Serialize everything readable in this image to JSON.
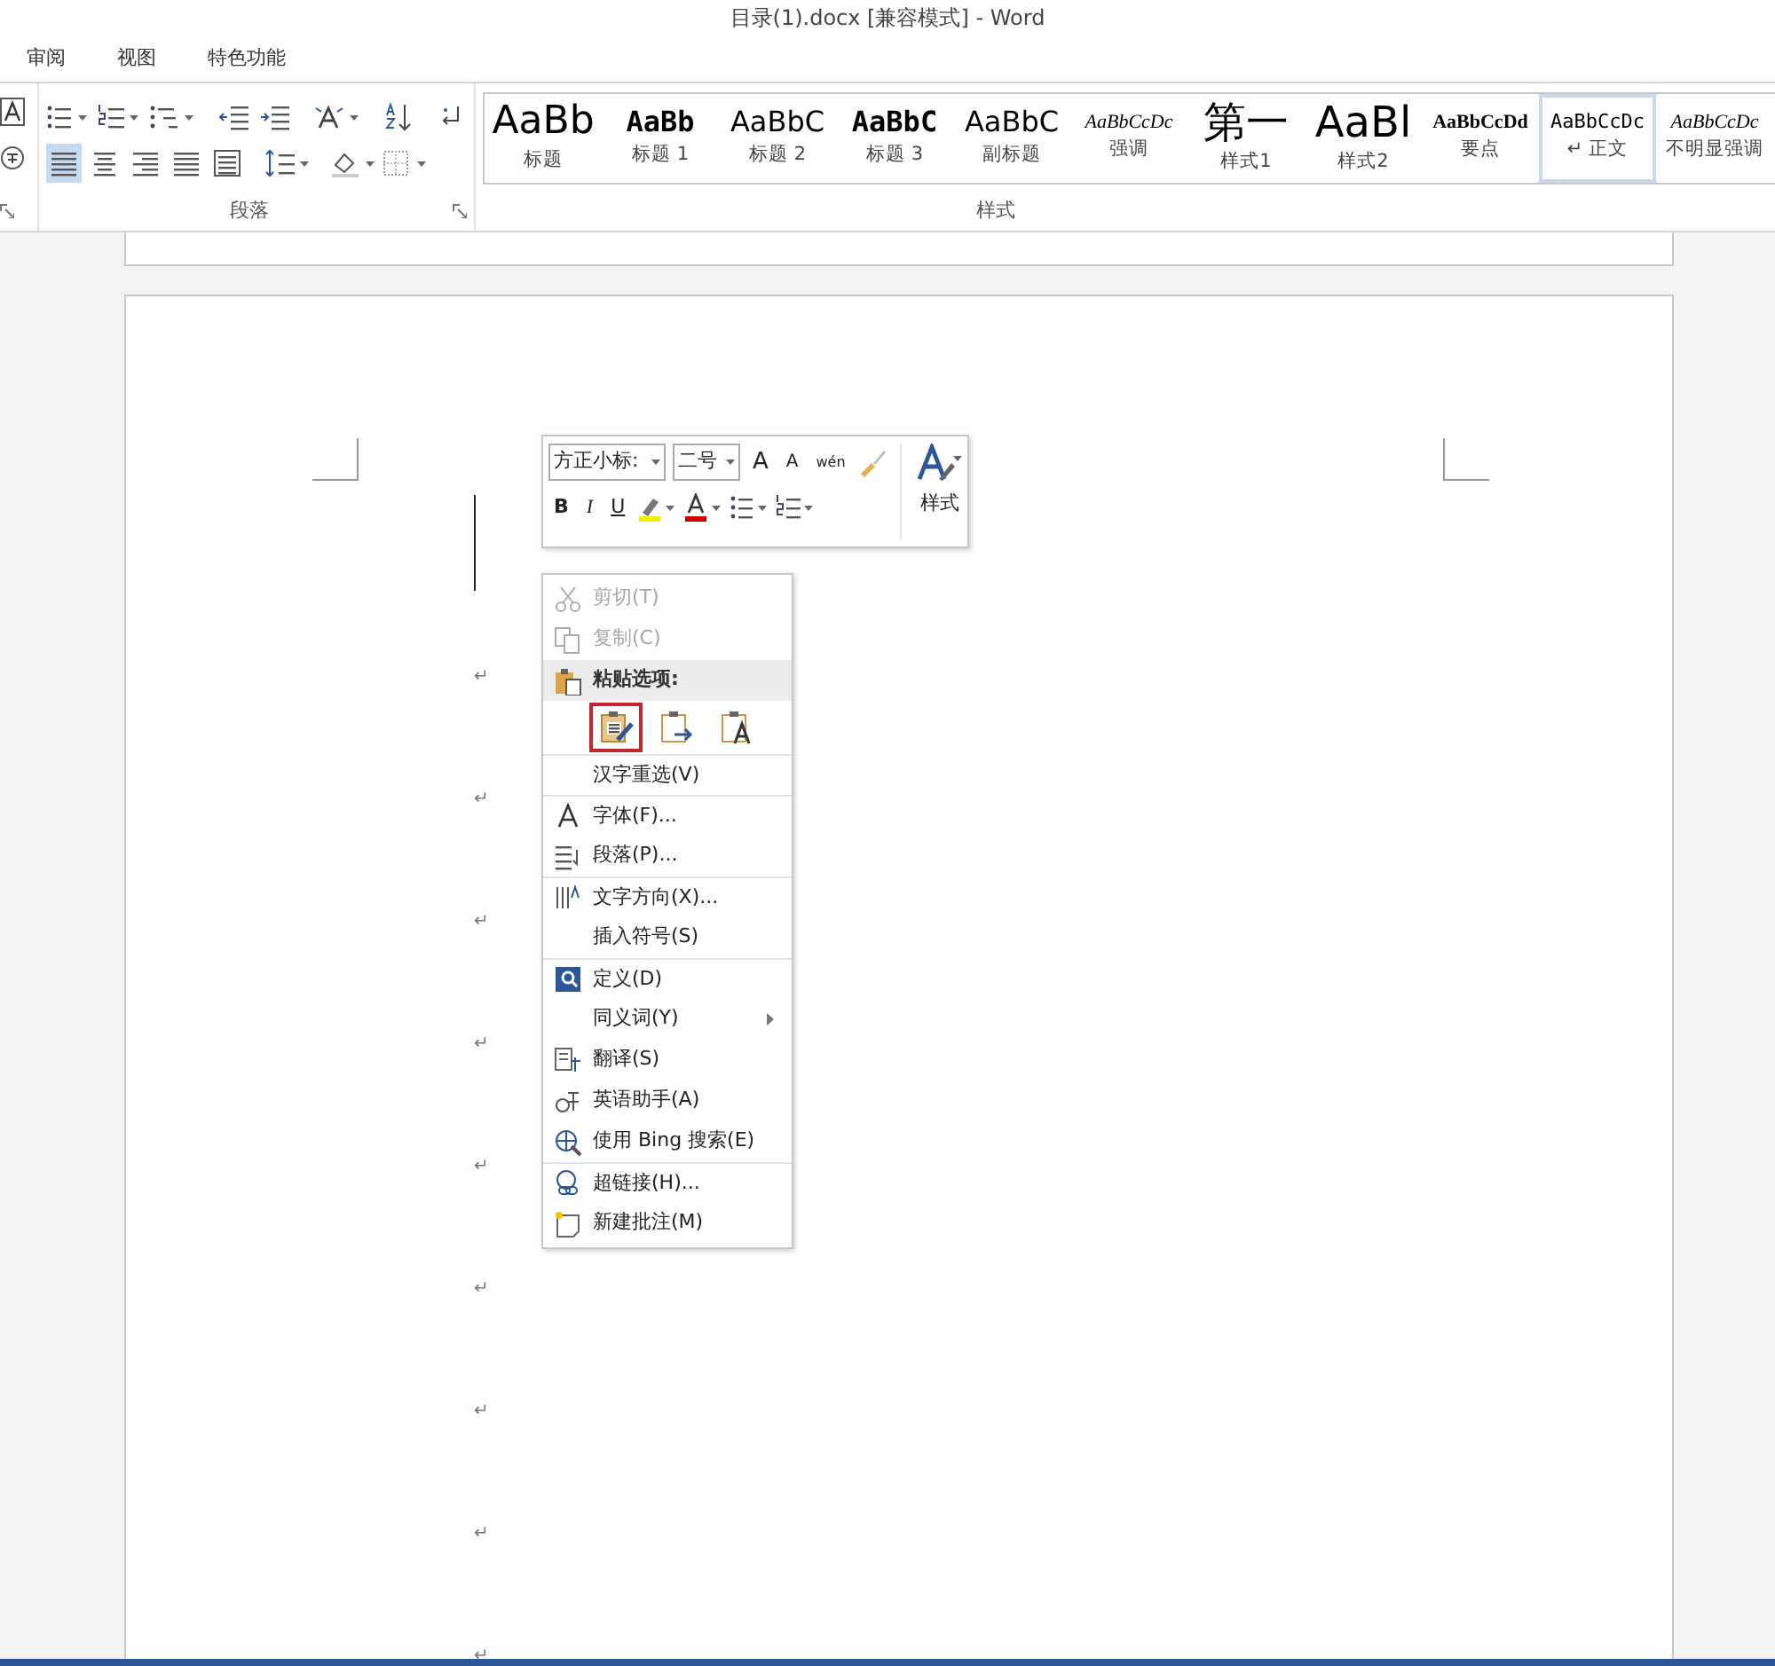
{
  "window": {
    "title": "目录(1).docx [兼容模式] - Word"
  },
  "tabs": [
    {
      "label": "审阅"
    },
    {
      "label": "视图"
    },
    {
      "label": "特色功能"
    }
  ],
  "paragraph_group": {
    "label": "段落",
    "alignment_buttons": [
      {
        "selected": true
      },
      {
        "selected": false
      },
      {
        "selected": false
      },
      {
        "selected": false
      },
      {
        "selected": false
      }
    ]
  },
  "styles_group": {
    "label": "样式",
    "items": [
      {
        "preview": "AaBb",
        "label": "标题",
        "kind": "title",
        "selected": false
      },
      {
        "preview": "AaBb",
        "label": "标题 1",
        "kind": "mono",
        "selected": false
      },
      {
        "preview": "AaBbC",
        "label": "标题 2",
        "kind": "sans",
        "selected": false
      },
      {
        "preview": "AaBbC",
        "label": "标题 3",
        "kind": "mono",
        "selected": false
      },
      {
        "preview": "AaBbC",
        "label": "副标题",
        "kind": "sans",
        "selected": false
      },
      {
        "preview": "AaBbCcDc",
        "label": "强调",
        "kind": "italic",
        "selected": false
      },
      {
        "preview": "第一",
        "label": "样式1",
        "kind": "big",
        "selected": false
      },
      {
        "preview": "AaBl",
        "label": "样式2",
        "kind": "big",
        "selected": false
      },
      {
        "preview": "AaBbCcDd",
        "label": "要点",
        "kind": "bold",
        "selected": false
      },
      {
        "preview": "AaBbCcDc",
        "label": "↵ 正文",
        "kind": "serif",
        "selected": true
      },
      {
        "preview": "AaBbCcDc",
        "label": "不明显强调",
        "kind": "italic",
        "selected": false
      }
    ]
  },
  "mini_toolbar": {
    "font": "方正小标:",
    "size": "二号",
    "grow": "A",
    "shrink": "A",
    "phonetic": "wén",
    "bold": "B",
    "italic": "I",
    "underline": "U",
    "styles_label": "样式"
  },
  "context_menu": [
    {
      "kind": "item",
      "label": "剪切(T)",
      "disabled": true,
      "separator_before": false
    },
    {
      "kind": "item",
      "label": "复制(C)",
      "disabled": true,
      "separator_before": false
    },
    {
      "kind": "header",
      "label": "粘贴选项:",
      "disabled": false,
      "separator_before": false
    },
    {
      "kind": "paste",
      "options": [
        {
          "selected": true
        },
        {
          "selected": false
        },
        {
          "selected": false
        }
      ]
    },
    {
      "kind": "item",
      "label": "汉字重选(V)",
      "disabled": false,
      "separator_before": true
    },
    {
      "kind": "item",
      "label": "字体(F)...",
      "disabled": false,
      "separator_before": true
    },
    {
      "kind": "item",
      "label": "段落(P)...",
      "disabled": false,
      "separator_before": false
    },
    {
      "kind": "item",
      "label": "文字方向(X)...",
      "disabled": false,
      "separator_before": true
    },
    {
      "kind": "item",
      "label": "插入符号(S)",
      "disabled": false,
      "separator_before": false
    },
    {
      "kind": "item",
      "label": "定义(D)",
      "disabled": false,
      "separator_before": true
    },
    {
      "kind": "submenu",
      "label": "同义词(Y)",
      "disabled": false,
      "separator_before": false
    },
    {
      "kind": "item",
      "label": "翻译(S)",
      "disabled": false,
      "separator_before": false
    },
    {
      "kind": "item",
      "label": "英语助手(A)",
      "disabled": false,
      "separator_before": false
    },
    {
      "kind": "item",
      "label": "使用 Bing 搜索(E)",
      "disabled": false,
      "separator_before": false
    },
    {
      "kind": "item",
      "label": "超链接(H)...",
      "disabled": false,
      "separator_before": true
    },
    {
      "kind": "item",
      "label": "新建批注(M)",
      "disabled": false,
      "separator_before": false
    }
  ],
  "paragraph_marks": [
    "↵",
    "↵",
    "↵",
    "↵",
    "↵",
    "↵",
    "↵",
    "↵",
    "↵"
  ]
}
